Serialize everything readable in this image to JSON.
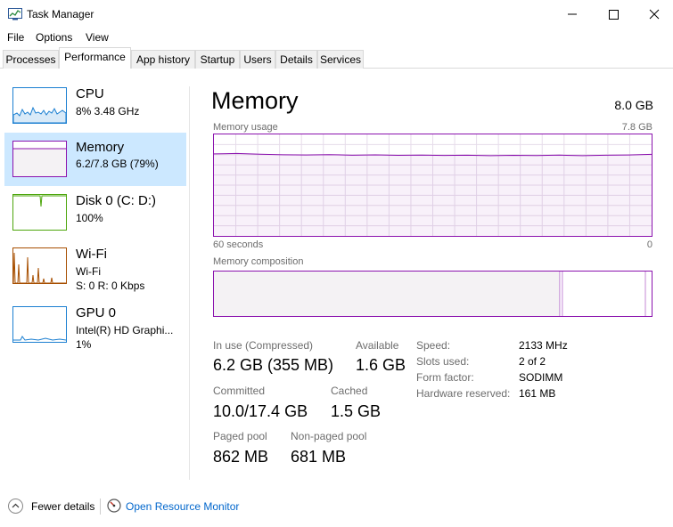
{
  "window": {
    "title": "Task Manager",
    "icon": "task-manager-icon",
    "minimize_icon": "minimize-icon",
    "maximize_icon": "maximize-icon",
    "close_icon": "close-icon"
  },
  "menu": [
    "File",
    "Options",
    "View"
  ],
  "tabs": [
    {
      "label": "Processes"
    },
    {
      "label": "Performance",
      "active": true
    },
    {
      "label": "App history"
    },
    {
      "label": "Startup"
    },
    {
      "label": "Users"
    },
    {
      "label": "Details"
    },
    {
      "label": "Services"
    }
  ],
  "sidebar": {
    "items": [
      {
        "title": "CPU",
        "line1": "8% 3.48 GHz",
        "line2": "",
        "color": "#1b7fd1"
      },
      {
        "title": "Memory",
        "line1": "6.2/7.8 GB (79%)",
        "line2": "",
        "color": "#8b12ae",
        "selected": true
      },
      {
        "title": "Disk 0 (C: D:)",
        "line1": "100%",
        "line2": "",
        "color": "#4da60c"
      },
      {
        "title": "Wi-Fi",
        "line1": "Wi-Fi",
        "line2": "S: 0 R: 0 Kbps",
        "color": "#a74f01"
      },
      {
        "title": "GPU 0",
        "line1": "Intel(R) HD Graphi...",
        "line2": "1%",
        "color": "#1b7fd1"
      }
    ]
  },
  "main": {
    "title": "Memory",
    "total": "8.0 GB",
    "usage_chart": {
      "label": "Memory usage",
      "max_label": "7.8 GB",
      "left_axis": "60 seconds",
      "right_axis": "0",
      "fill_level": 0.79
    },
    "composition_chart": {
      "label": "Memory composition",
      "in_use_fraction": 0.79
    },
    "stats": {
      "in_use_label": "In use (Compressed)",
      "in_use_value": "6.2 GB (355 MB)",
      "available_label": "Available",
      "available_value": "1.6 GB",
      "committed_label": "Committed",
      "committed_value": "10.0/17.4 GB",
      "cached_label": "Cached",
      "cached_value": "1.5 GB",
      "paged_pool_label": "Paged pool",
      "paged_pool_value": "862 MB",
      "nonpaged_pool_label": "Non-paged pool",
      "nonpaged_pool_value": "681 MB"
    },
    "specs": [
      {
        "label": "Speed:",
        "value": "2133 MHz"
      },
      {
        "label": "Slots used:",
        "value": "2 of 2"
      },
      {
        "label": "Form factor:",
        "value": "SODIMM"
      },
      {
        "label": "Hardware reserved:",
        "value": "161 MB"
      }
    ]
  },
  "footer": {
    "fewer_details": "Fewer details",
    "fewer_icon": "chevron-up-icon",
    "resource_monitor": "Open Resource Monitor",
    "resource_icon": "resource-monitor-icon"
  },
  "colors": {
    "memory": "#8b12ae",
    "selection": "#cce8ff",
    "link": "#0066cc"
  }
}
